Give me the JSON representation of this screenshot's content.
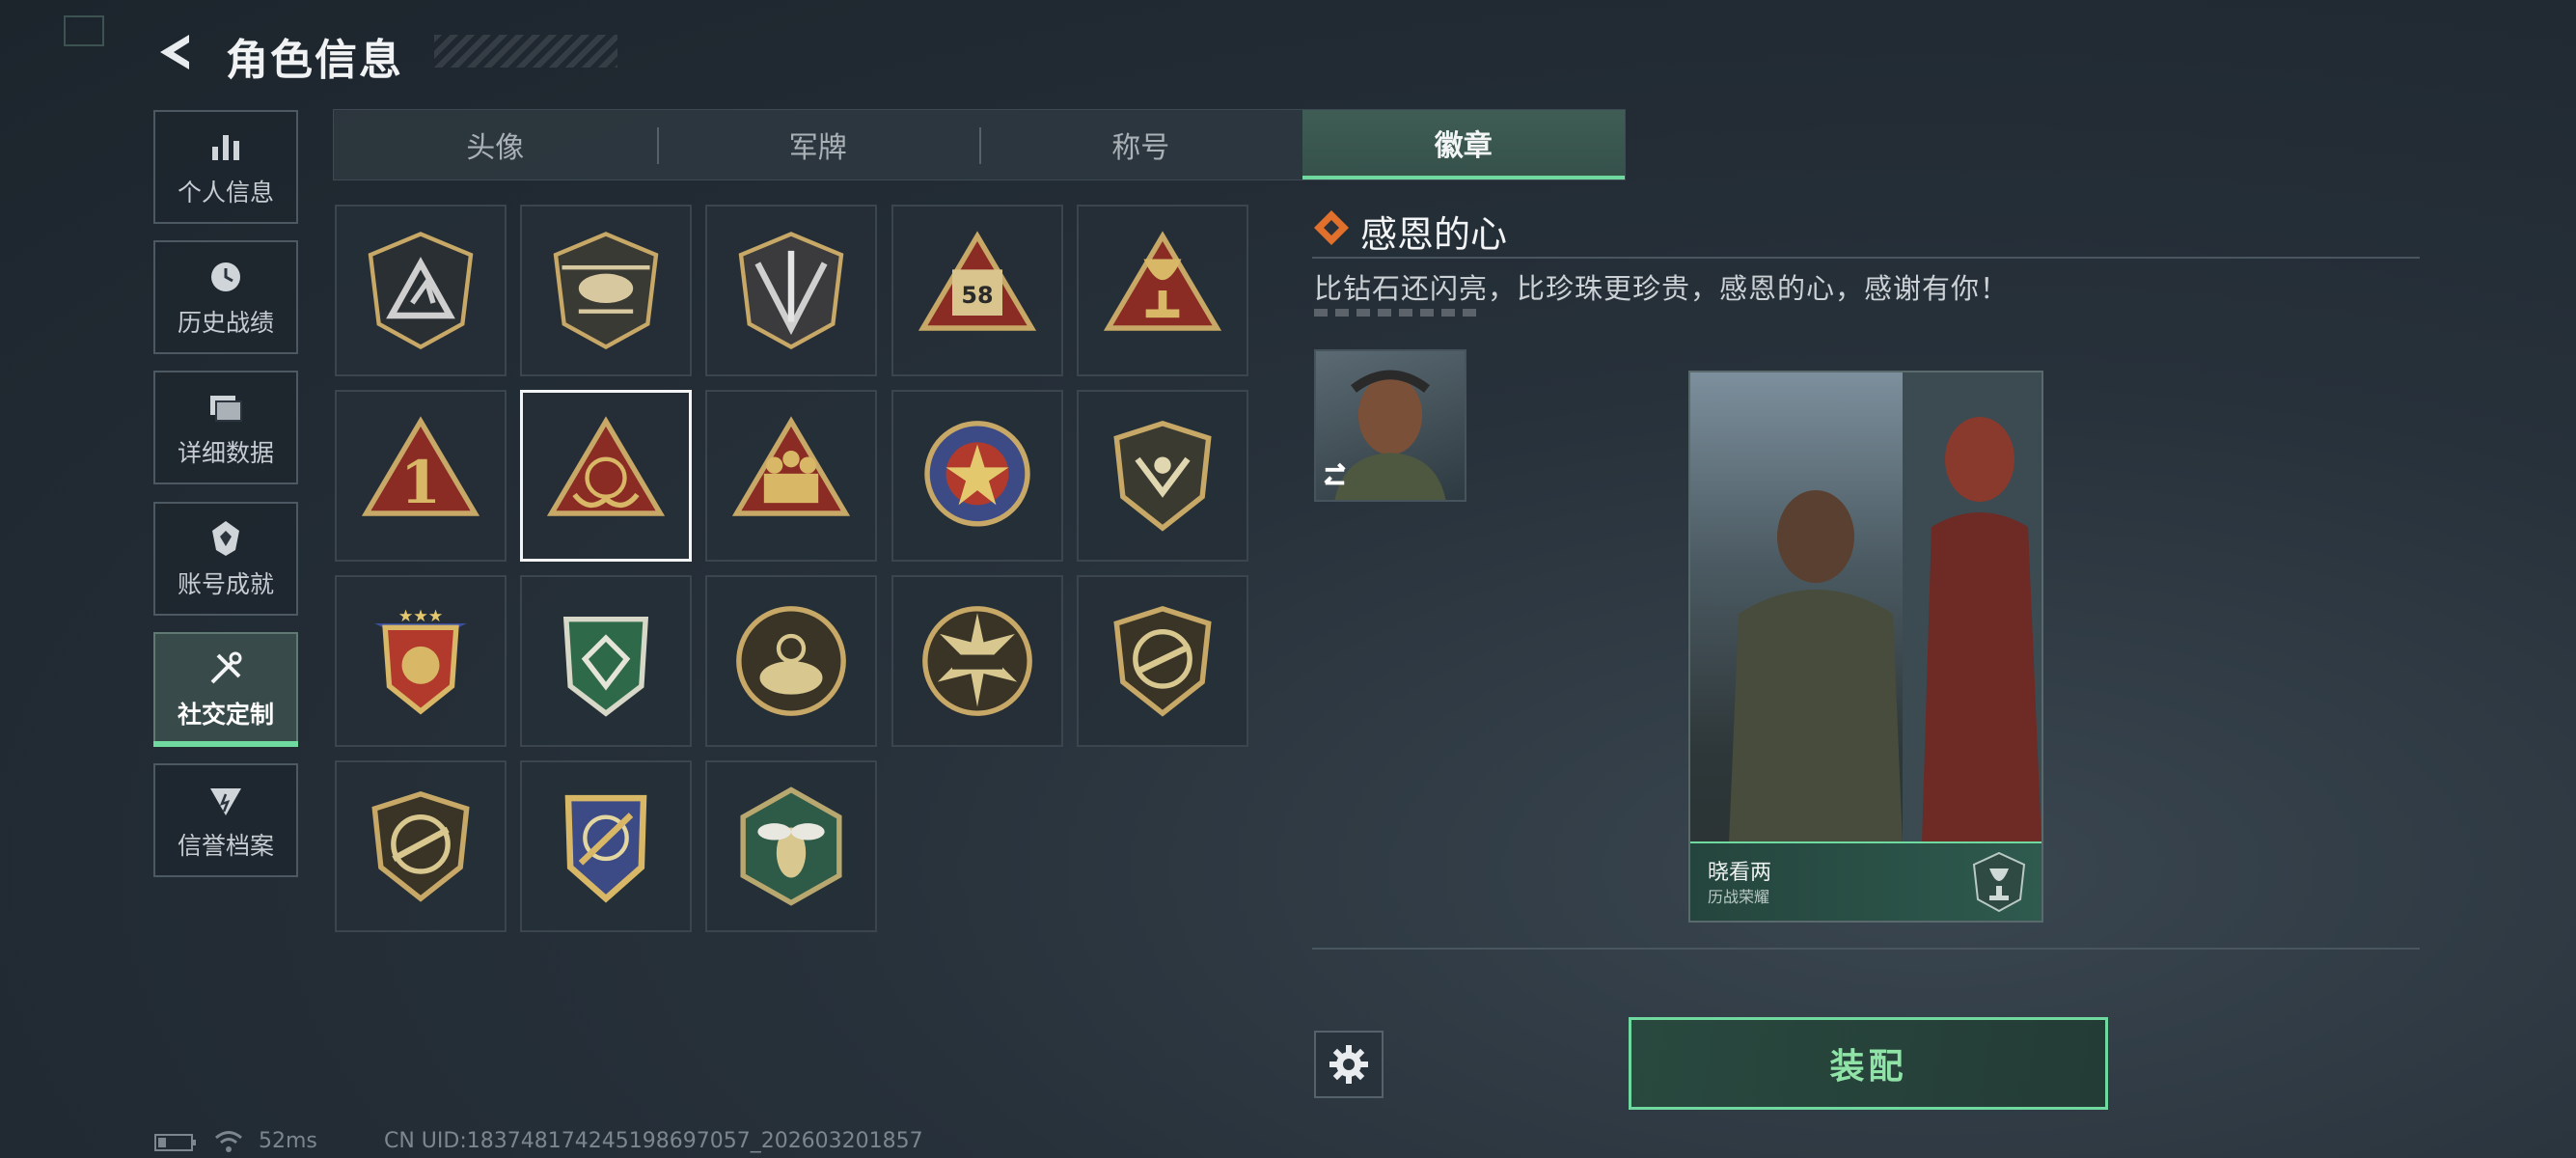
{
  "header": {
    "title": "角色信息"
  },
  "sidebar": {
    "items": [
      {
        "label": "个人信息",
        "icon": "bar-chart-icon"
      },
      {
        "label": "历史战绩",
        "icon": "history-icon"
      },
      {
        "label": "详细数据",
        "icon": "folder-icon"
      },
      {
        "label": "账号成就",
        "icon": "achievement-icon"
      },
      {
        "label": "社交定制",
        "icon": "tools-icon",
        "active": true
      },
      {
        "label": "信誉档案",
        "icon": "credit-icon"
      }
    ]
  },
  "tabs": [
    {
      "label": "头像"
    },
    {
      "label": "军牌"
    },
    {
      "label": "称号"
    },
    {
      "label": "徽章",
      "active": true
    }
  ],
  "badges": {
    "selected_index": 6,
    "items": [
      {
        "icon": "triangle-a-badge-icon"
      },
      {
        "icon": "helicopter-badge-icon"
      },
      {
        "icon": "dagger-shield-badge-icon"
      },
      {
        "icon": "58-truck-badge-icon",
        "text": "58"
      },
      {
        "icon": "trophy-triangle-badge-icon"
      },
      {
        "icon": "number-one-badge-icon",
        "text": "1"
      },
      {
        "icon": "grateful-heart-badge-icon"
      },
      {
        "icon": "soldiers-badge-icon"
      },
      {
        "icon": "star-emblem-badge-icon"
      },
      {
        "icon": "wing-shield-badge-icon"
      },
      {
        "icon": "star-medal-badge-icon"
      },
      {
        "icon": "green-diamond-badge-icon"
      },
      {
        "icon": "crosshair-badge-icon"
      },
      {
        "icon": "tank-badge-icon"
      },
      {
        "icon": "rifle-badge-icon"
      },
      {
        "icon": "no-rifle-badge-icon"
      },
      {
        "icon": "target-knife-badge-icon"
      },
      {
        "icon": "wasp-hex-badge-icon"
      }
    ]
  },
  "detail": {
    "name": "感恩的心",
    "description": "比钻石还闪亮，比珍珠更珍贵，感恩的心，感谢有你！",
    "card": {
      "name": "晓看两",
      "subtitle": "历战荣耀"
    },
    "equip_label": "装配"
  },
  "status": {
    "ping": "52ms",
    "uid": "CN UID:18374817424519869705​7_202603201857"
  },
  "colors": {
    "accent": "#6fd9a0",
    "gold": "#c8a866",
    "badge_red": "#8a2c24"
  }
}
